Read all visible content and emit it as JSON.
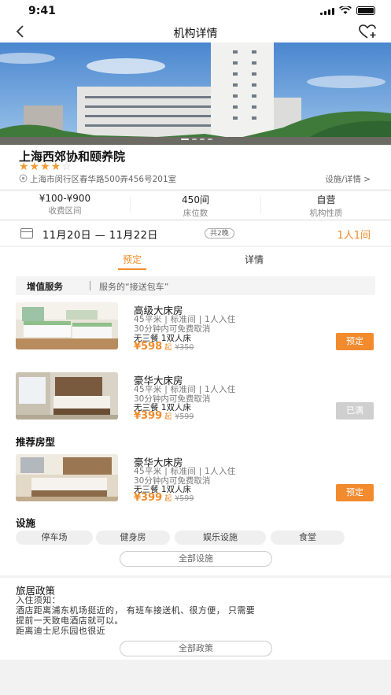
{
  "status_bar": {
    "time": "9:41"
  },
  "nav": {
    "title": "机构详情"
  },
  "institution": {
    "name": "上海西郊协和颐养院",
    "rating_stars": 4,
    "rating_max": 5,
    "address": "上海市闵行区春华路500弄456号201室",
    "facilities_link": "设施/详情 >"
  },
  "stats": [
    {
      "value": "¥100-¥900",
      "label": "收费区间"
    },
    {
      "value": "450间",
      "label": "床位数"
    },
    {
      "value": "自营",
      "label": "机构性质"
    }
  ],
  "booking": {
    "date_range": "11月20日 — 11月22日",
    "nights": "共2晚",
    "guests": "1人1间"
  },
  "tabs": [
    {
      "label": "预定",
      "active": true
    },
    {
      "label": "详情",
      "active": false
    }
  ],
  "value_service": {
    "title": "增值服务",
    "desc": "服务的“接送包车”"
  },
  "rooms": [
    {
      "name": "高级大床房",
      "spec": "45平米 | 标准间 | 1人入住",
      "cancel": "30分钟内可免费取消",
      "meal": "无三餐 1双人床",
      "price": "¥598",
      "qi": "起",
      "old_price": "¥350",
      "button": "预定",
      "available": true
    },
    {
      "name": "豪华大床房",
      "spec": "45平米 | 标准间 | 1人入住",
      "cancel": "30分钟内可免费取消",
      "meal": "无三餐 1双人床",
      "price": "¥399",
      "qi": "起",
      "old_price": "¥599",
      "button": "已满",
      "available": false
    }
  ],
  "recommended": {
    "title": "推荐房型",
    "rooms": [
      {
        "name": "豪华大床房",
        "spec": "45平米 | 标准间 | 1人入住",
        "cancel": "30分钟内可免费取消",
        "meal": "无三餐 1双人床",
        "price": "¥399",
        "qi": "起",
        "old_price": "¥599",
        "button": "预定",
        "available": true
      }
    ]
  },
  "facilities": {
    "title": "设施",
    "items": [
      "停车场",
      "健身房",
      "娱乐设施",
      "食堂"
    ],
    "all_button": "全部设施"
  },
  "policy": {
    "title": "旅居政策",
    "lines": [
      "入住须知：",
      "酒店距离浦东机场挺近的， 有班车接送机、很方便， 只需要",
      "提前一天致电酒店就可以。",
      "距离迪士尼乐园也很近"
    ],
    "all_button": "全部政策"
  },
  "colors": {
    "accent": "#f08b2a",
    "button_disabled": "#cfcfcf",
    "star": "#f39a2f"
  }
}
